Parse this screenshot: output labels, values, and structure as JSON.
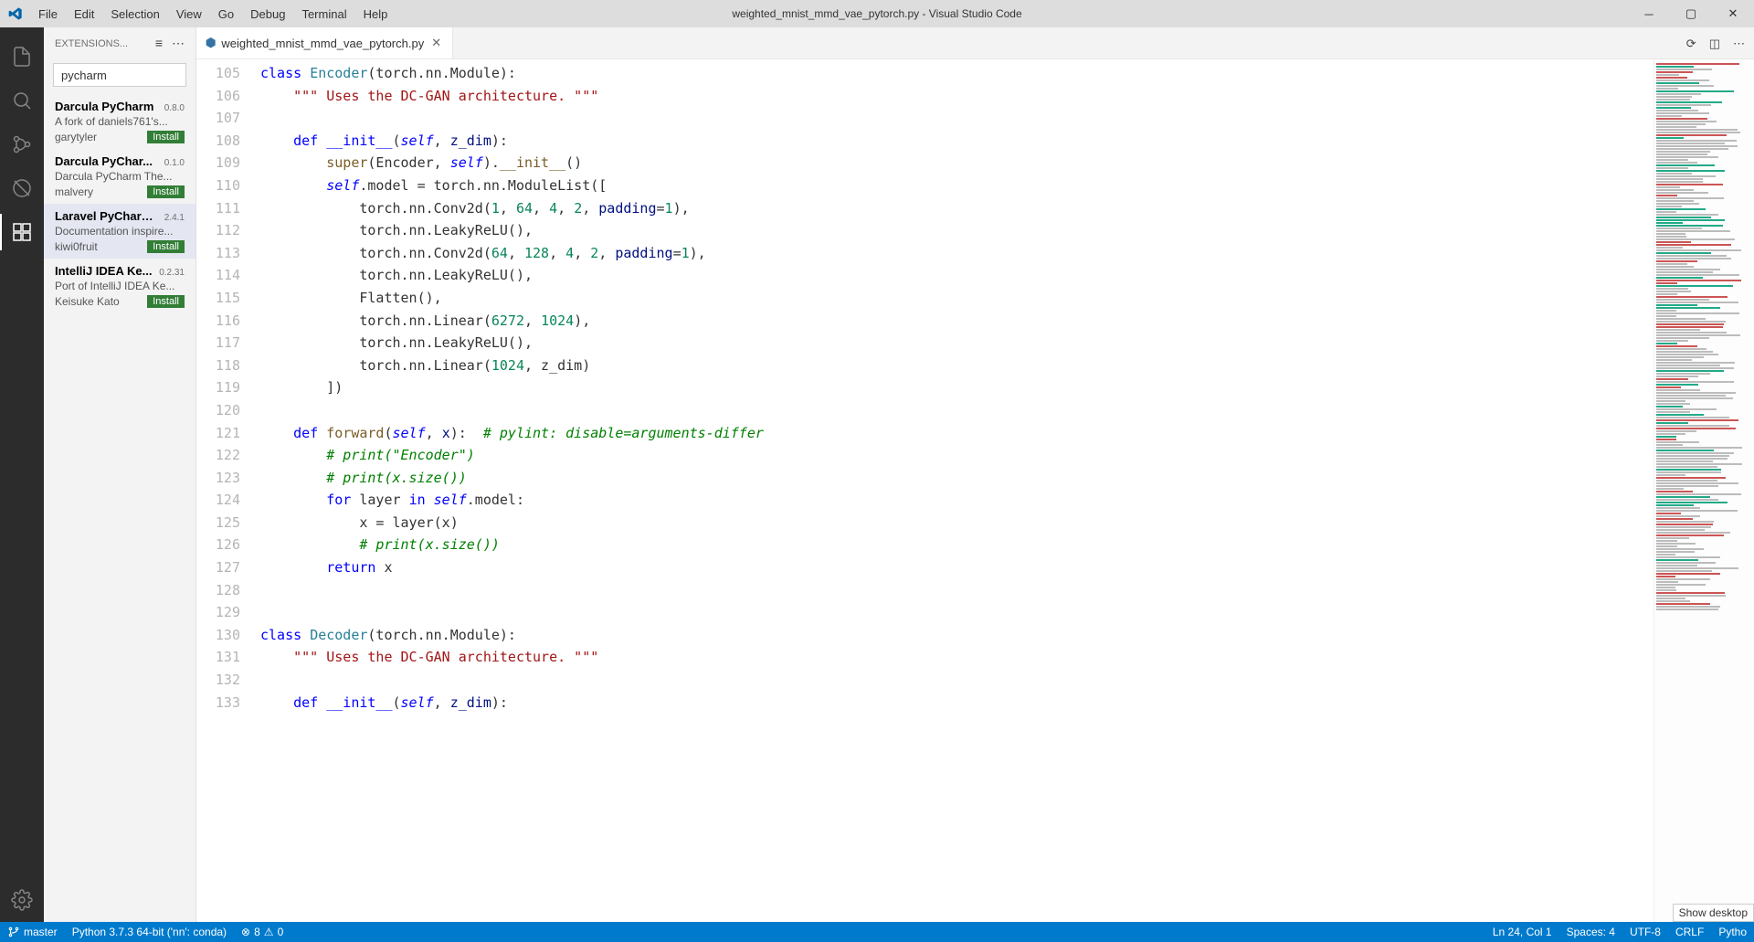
{
  "menus": [
    "File",
    "Edit",
    "Selection",
    "View",
    "Go",
    "Debug",
    "Terminal",
    "Help"
  ],
  "window_title": "weighted_mnist_mmd_vae_pytorch.py - Visual Studio Code",
  "sidebar": {
    "header": "EXTENSIONS...",
    "search_value": "pycharm",
    "items": [
      {
        "name": "Darcula PyCharm",
        "version": "0.8.0",
        "desc": "A fork of daniels761's...",
        "author": "garytyler",
        "install": "Install"
      },
      {
        "name": "Darcula PyChar...",
        "version": "0.1.0",
        "desc": "Darcula PyCharm The...",
        "author": "malvery",
        "install": "Install"
      },
      {
        "name": "Laravel PyCharm...",
        "version": "2.4.1",
        "desc": "Documentation inspire...",
        "author": "kiwi0fruit",
        "install": "Install"
      },
      {
        "name": "IntelliJ IDEA Ke...",
        "version": "0.2.31",
        "desc": "Port of IntelliJ IDEA Ke...",
        "author": "Keisuke Kato",
        "install": "Install"
      }
    ]
  },
  "tab": {
    "label": "weighted_mnist_mmd_vae_pytorch.py"
  },
  "line_start": 105,
  "line_end": 133,
  "code_lines": [
    "<span class='kw'>class</span> <span class='cls'>Encoder</span>(torch.nn.Module):",
    "    <span class='str'>\"\"\" Uses the DC-GAN architecture. \"\"\"</span>",
    "",
    "    <span class='kw'>def</span> <span class='mag'>__init__</span>(<span class='self'>self</span>, <span class='param'>z_dim</span>):",
    "        <span class='fn'>super</span>(Encoder, <span class='self'>self</span>).<span class='fn'>__init__</span>()",
    "        <span class='self'>self</span>.model = torch.nn.ModuleList([",
    "            torch.nn.Conv2d(<span class='num'>1</span>, <span class='num'>64</span>, <span class='num'>4</span>, <span class='num'>2</span>, <span class='param'>padding</span>=<span class='num'>1</span>),",
    "            torch.nn.LeakyReLU(),",
    "            torch.nn.Conv2d(<span class='num'>64</span>, <span class='num'>128</span>, <span class='num'>4</span>, <span class='num'>2</span>, <span class='param'>padding</span>=<span class='num'>1</span>),",
    "            torch.nn.LeakyReLU(),",
    "            Flatten(),",
    "            torch.nn.Linear(<span class='num'>6272</span>, <span class='num'>1024</span>),",
    "            torch.nn.LeakyReLU(),",
    "            torch.nn.Linear(<span class='num'>1024</span>, z_dim)",
    "        ])",
    "",
    "    <span class='kw'>def</span> <span class='fn'>forward</span>(<span class='self'>self</span>, <span class='param'>x</span>):  <span class='cmt'># pylint: disable=arguments-differ</span>",
    "        <span class='cmt'># print(\"Encoder\")</span>",
    "        <span class='cmt'># print(x.size())</span>",
    "        <span class='kw'>for</span> layer <span class='kw'>in</span> <span class='self'>self</span>.model:",
    "            x = layer(x)",
    "            <span class='cmt'># print(x.size())</span>",
    "        <span class='kw'>return</span> x",
    "",
    "",
    "<span class='kw'>class</span> <span class='cls'>Decoder</span>(torch.nn.Module):",
    "    <span class='str'>\"\"\" Uses the DC-GAN architecture. \"\"\"</span>",
    "",
    "    <span class='kw'>def</span> <span class='mag'>__init__</span>(<span class='self'>self</span>, <span class='param'>z_dim</span>):"
  ],
  "status": {
    "branch": "master",
    "python": "Python 3.7.3 64-bit ('nn': conda)",
    "errors": "8",
    "warnings": "0",
    "cursor": "Ln 24, Col 1",
    "spaces": "Spaces: 4",
    "encoding": "UTF-8",
    "eol": "CRLF",
    "lang": "Pytho"
  },
  "tooltip": "Show desktop"
}
